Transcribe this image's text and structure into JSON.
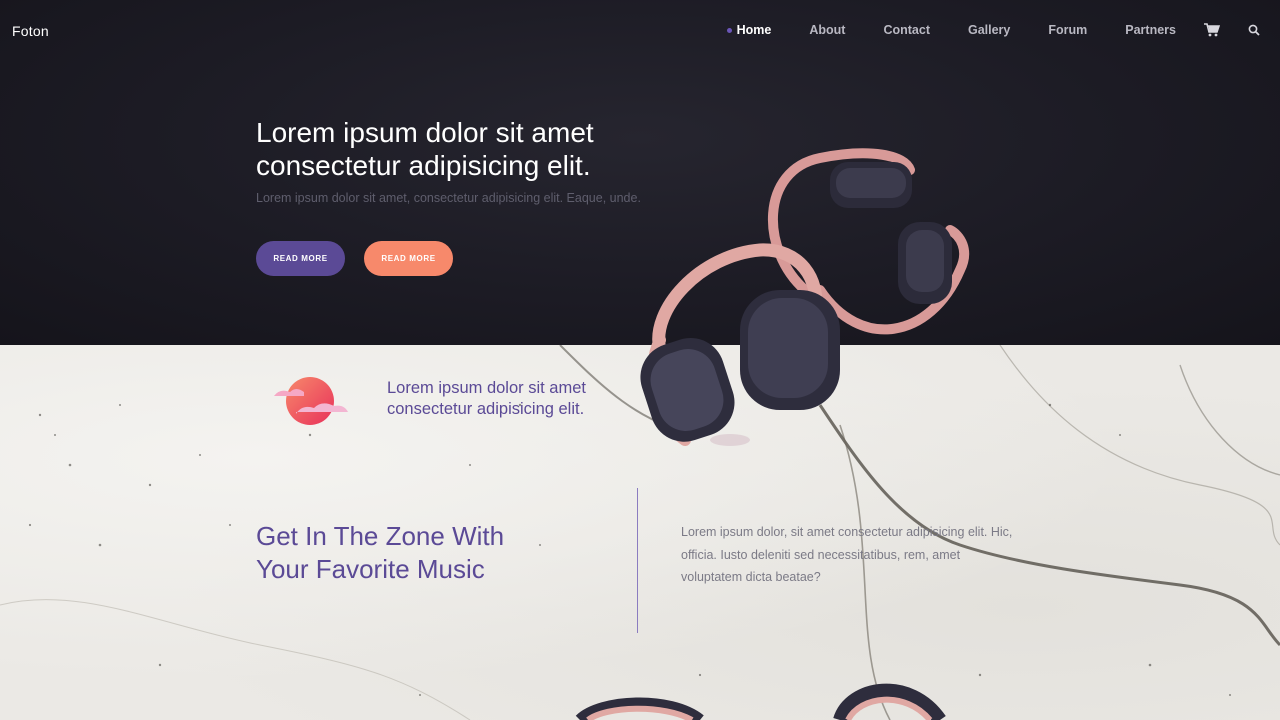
{
  "brand": "Foton",
  "nav": {
    "items": [
      {
        "label": "Home",
        "active": true
      },
      {
        "label": "About",
        "active": false
      },
      {
        "label": "Contact",
        "active": false
      },
      {
        "label": "Gallery",
        "active": false
      },
      {
        "label": "Forum",
        "active": false
      },
      {
        "label": "Partners",
        "active": false
      }
    ],
    "icons": [
      "cart-icon",
      "search-icon"
    ]
  },
  "hero": {
    "title_line1": "Lorem ipsum dolor sit amet",
    "title_line2": "consectetur adipisicing elit.",
    "subtitle": "Lorem ipsum dolor sit amet, consectetur adipisicing elit. Eaque, unde.",
    "btn1_label": "READ MORE",
    "btn2_label": "READ MORE"
  },
  "feature": {
    "title_line1": "Lorem ipsum dolor sit amet",
    "title_line2": "consectetur adipisicing elit."
  },
  "zone": {
    "title_line1": "Get In The Zone With",
    "title_line2": "Your Favorite Music",
    "text": "Lorem ipsum dolor, sit amet consectetur adipisicing elit. Hic, officia. Iusto deleniti sed necessitatibus, rem, amet voluptatem dicta beatae?"
  },
  "colors": {
    "accent_purple": "#5b4a96",
    "accent_orange": "#f7896b",
    "hero_bg": "#1c1b24"
  }
}
